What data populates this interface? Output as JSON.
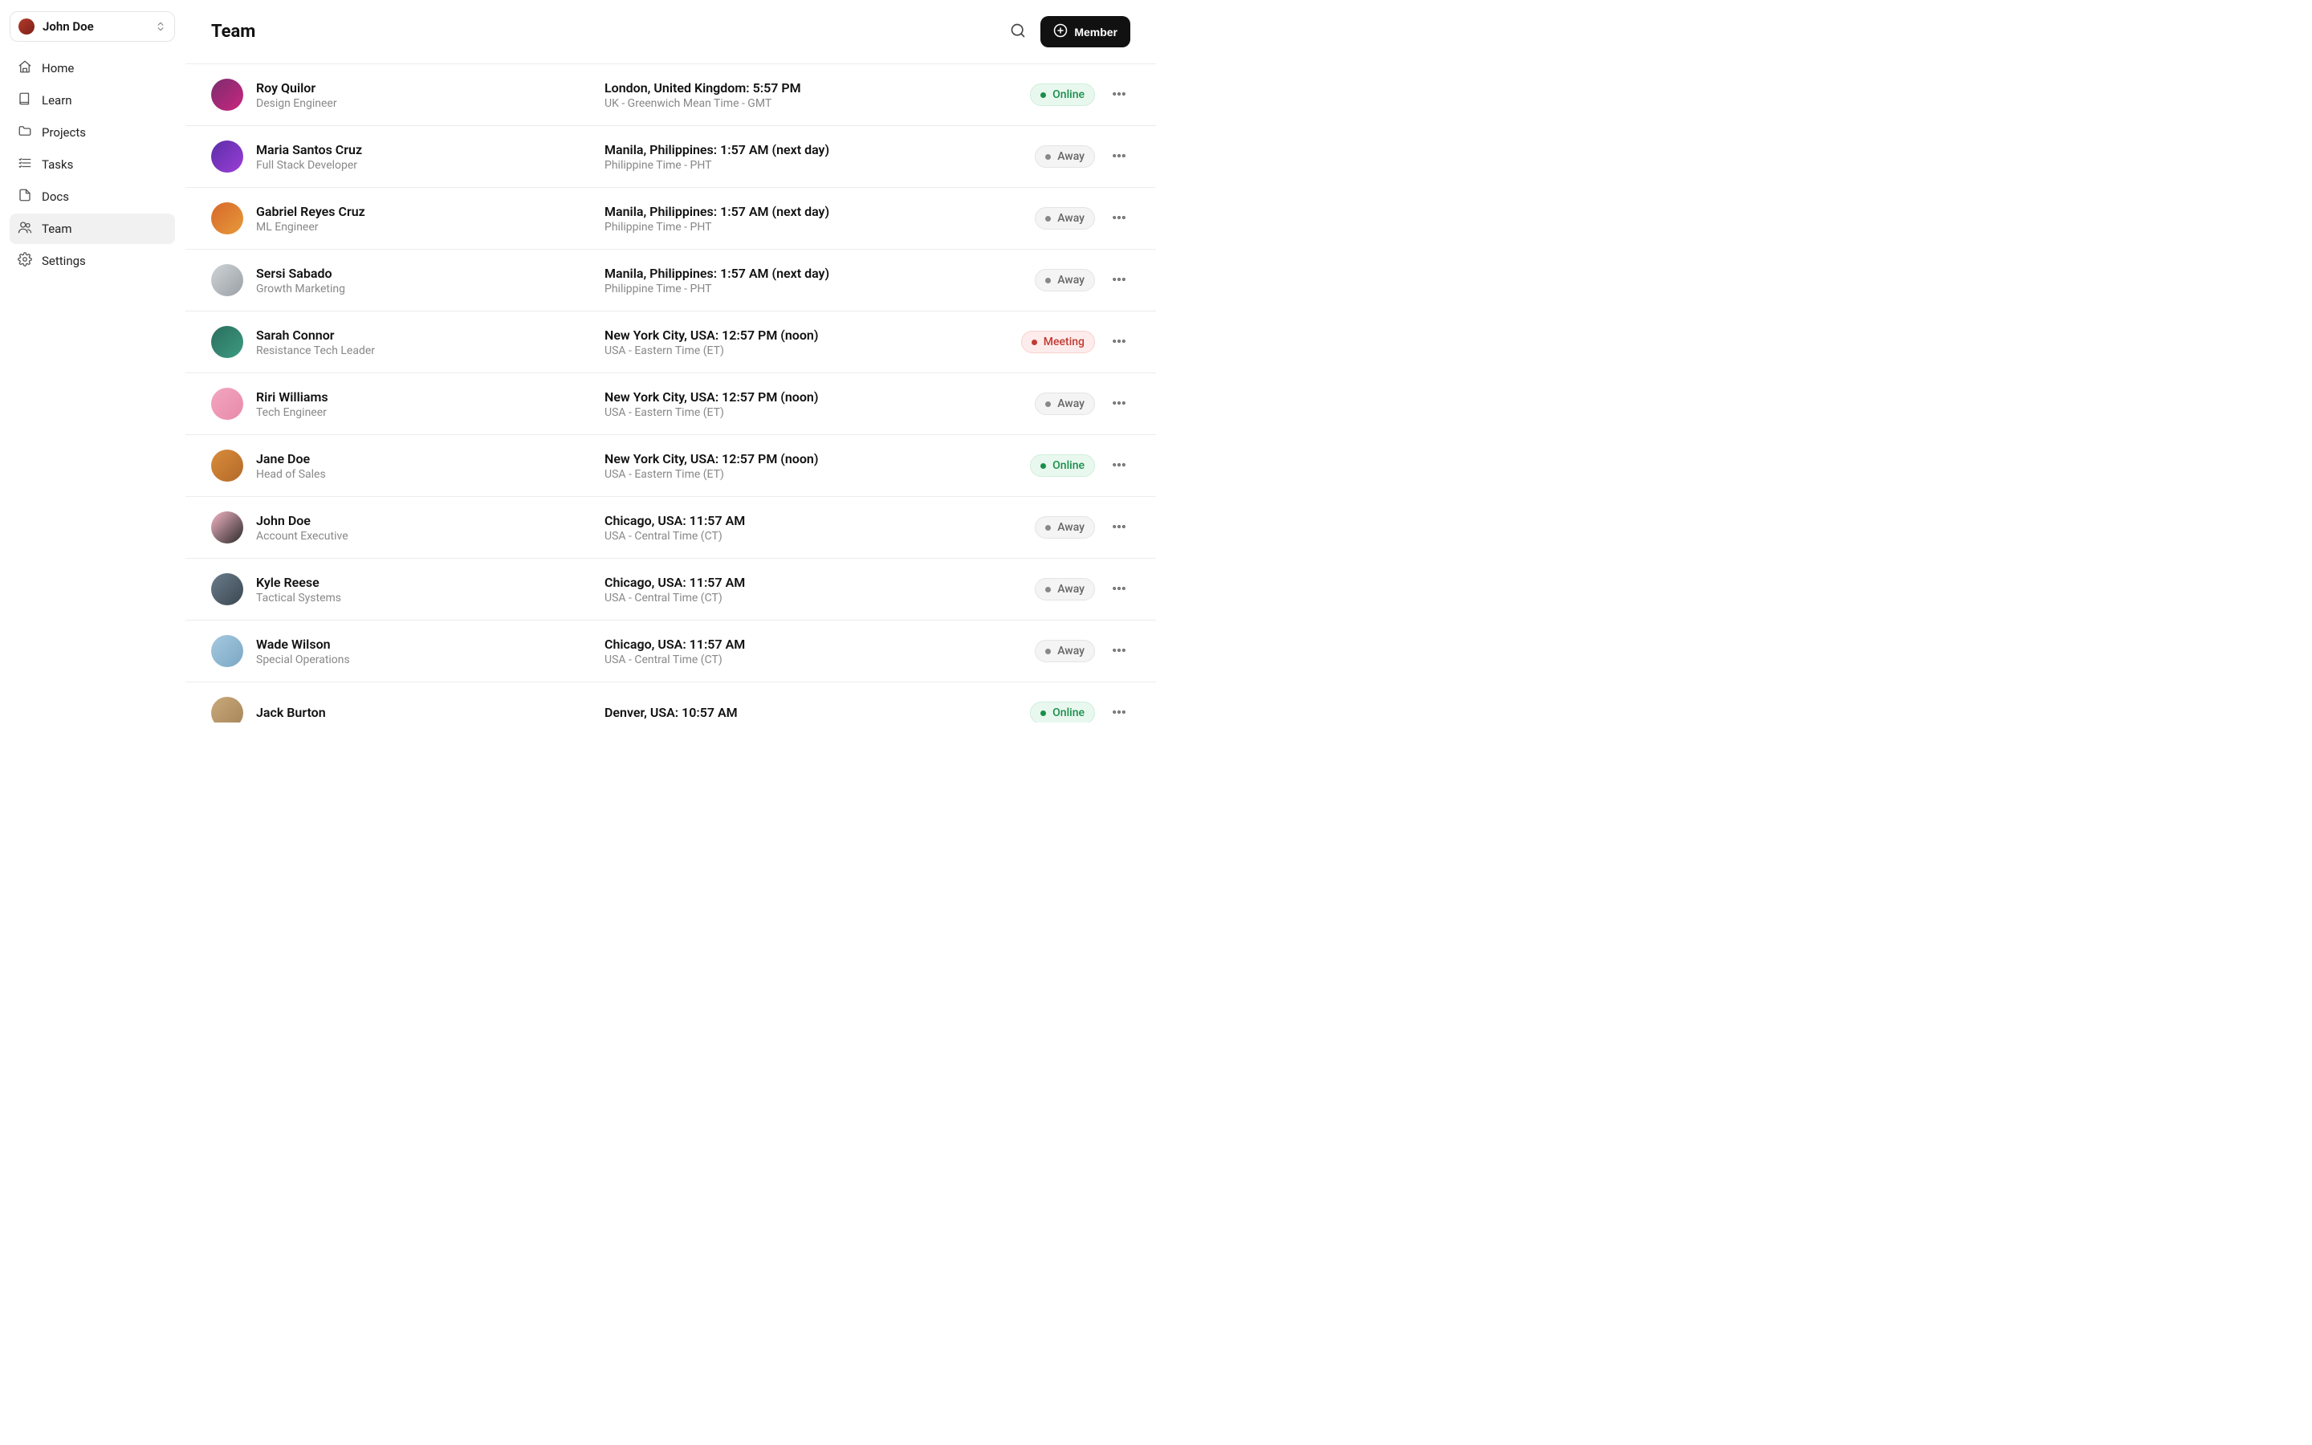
{
  "account": {
    "name": "John Doe"
  },
  "sidebar": {
    "items": [
      {
        "label": "Home",
        "icon": "home"
      },
      {
        "label": "Learn",
        "icon": "book"
      },
      {
        "label": "Projects",
        "icon": "folder"
      },
      {
        "label": "Tasks",
        "icon": "tasks"
      },
      {
        "label": "Docs",
        "icon": "file"
      },
      {
        "label": "Team",
        "icon": "users",
        "active": true
      },
      {
        "label": "Settings",
        "icon": "gear"
      }
    ]
  },
  "header": {
    "title": "Team",
    "add_button_label": "Member"
  },
  "status_labels": {
    "online": "Online",
    "away": "Away",
    "meeting": "Meeting"
  },
  "members": [
    {
      "name": "Roy Quilor",
      "role": "Design Engineer",
      "location": "London, United Kingdom: 5:57 PM",
      "timezone": "UK - Greenwich Mean Time - GMT",
      "status": "online"
    },
    {
      "name": "Maria Santos Cruz",
      "role": "Full Stack Developer",
      "location": "Manila, Philippines: 1:57 AM (next day)",
      "timezone": "Philippine Time - PHT",
      "status": "away"
    },
    {
      "name": "Gabriel Reyes Cruz",
      "role": "ML Engineer",
      "location": "Manila, Philippines: 1:57 AM (next day)",
      "timezone": "Philippine Time - PHT",
      "status": "away"
    },
    {
      "name": "Sersi Sabado",
      "role": "Growth Marketing",
      "location": "Manila, Philippines: 1:57 AM (next day)",
      "timezone": "Philippine Time - PHT",
      "status": "away"
    },
    {
      "name": "Sarah Connor",
      "role": "Resistance Tech Leader",
      "location": "New York City, USA: 12:57 PM (noon)",
      "timezone": "USA - Eastern Time (ET)",
      "status": "meeting"
    },
    {
      "name": "Riri Williams",
      "role": "Tech Engineer",
      "location": "New York City, USA: 12:57 PM (noon)",
      "timezone": "USA - Eastern Time (ET)",
      "status": "away"
    },
    {
      "name": "Jane Doe",
      "role": "Head of Sales",
      "location": "New York City, USA: 12:57 PM (noon)",
      "timezone": "USA - Eastern Time (ET)",
      "status": "online"
    },
    {
      "name": "John Doe",
      "role": "Account Executive",
      "location": "Chicago, USA: 11:57 AM",
      "timezone": "USA - Central Time (CT)",
      "status": "away"
    },
    {
      "name": "Kyle Reese",
      "role": "Tactical Systems",
      "location": "Chicago, USA: 11:57 AM",
      "timezone": "USA - Central Time (CT)",
      "status": "away"
    },
    {
      "name": "Wade Wilson",
      "role": "Special Operations",
      "location": "Chicago, USA: 11:57 AM",
      "timezone": "USA - Central Time (CT)",
      "status": "away"
    },
    {
      "name": "Jack Burton",
      "role": "",
      "location": "Denver, USA: 10:57 AM",
      "timezone": "",
      "status": "online"
    }
  ]
}
